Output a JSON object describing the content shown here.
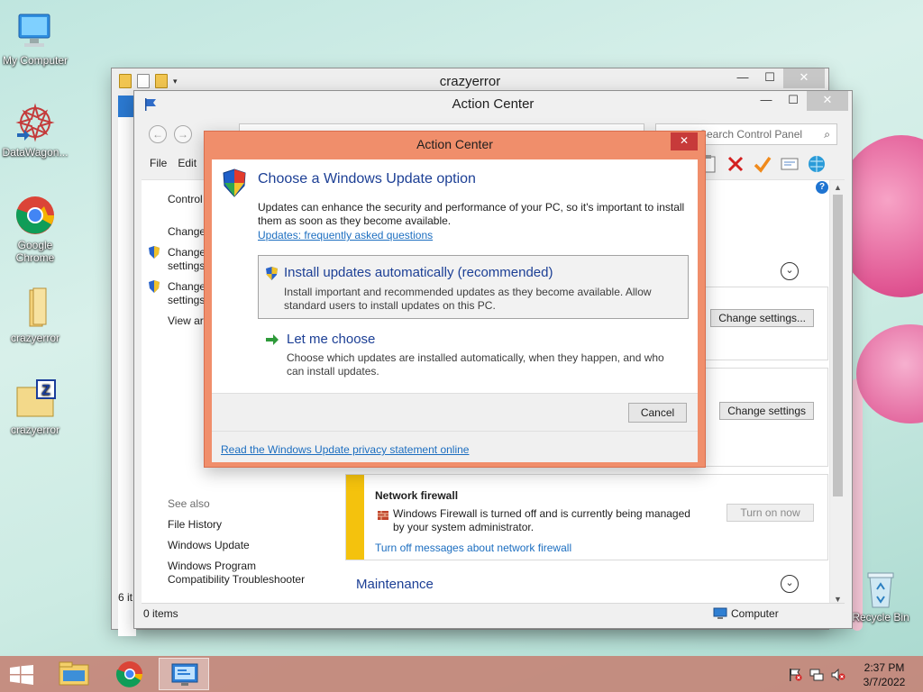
{
  "desktop": {
    "icons": [
      {
        "label": "My Computer"
      },
      {
        "label": "DataWagon..."
      },
      {
        "label": "Google Chrome"
      },
      {
        "label": "crazyerror"
      },
      {
        "label": "crazyerror"
      },
      {
        "label": "Recycle Bin"
      }
    ]
  },
  "explorer_window": {
    "title": "crazyerror",
    "status_partial": "6 it"
  },
  "action_center_window": {
    "title": "Action Center",
    "search_placeholder": "Search Control Panel",
    "menu": [
      "File",
      "Edit"
    ],
    "left_pane": {
      "items": [
        "Control",
        "Change",
        "Change\nsettings",
        "Change\nsettings",
        "View arc"
      ],
      "see_also_heading": "See also",
      "see_also": [
        "File History",
        "Windows Update",
        "Windows Program\nCompatibility Troubleshooter"
      ]
    },
    "right_pane": {
      "change_settings_btn1": "Change settings...",
      "change_settings_btn2": "Change settings",
      "firewall": {
        "title": "Network firewall",
        "message": "Windows Firewall is turned off and is currently being managed by your system administrator.",
        "turn_on_btn": "Turn on now",
        "turn_off_link": "Turn off messages about network firewall"
      },
      "maintenance_heading": "Maintenance"
    },
    "status": {
      "items": "0 items",
      "location": "Computer"
    }
  },
  "dialog": {
    "title": "Action Center",
    "heading": "Choose a Windows Update option",
    "description": "Updates can enhance the security and performance of your PC, so it's important to install them as soon as they become available.",
    "faq_link": "Updates: frequently asked questions",
    "options": [
      {
        "title": "Install updates automatically (recommended)",
        "description": "Install important and recommended updates as they become available. Allow standard users to install updates on this PC."
      },
      {
        "title": "Let me choose",
        "description": "Choose which updates are installed automatically, when they happen, and who can install updates."
      }
    ],
    "cancel_label": "Cancel",
    "privacy_link": "Read the Windows Update privacy statement online"
  },
  "taskbar": {
    "time": "2:37 PM",
    "date": "3/7/2022"
  },
  "colors": {
    "accent_dialog": "#f08e6b",
    "taskbar": "#c48678",
    "link": "#1c6ec0",
    "heading_blue": "#1c3f95",
    "firewall_bar": "#f4c20d"
  }
}
